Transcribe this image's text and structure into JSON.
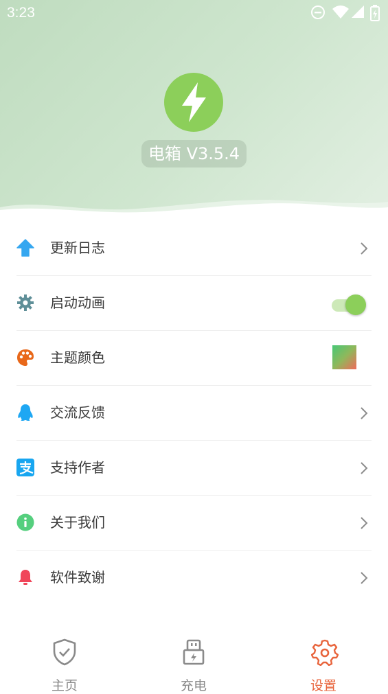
{
  "status_bar": {
    "time": "3:23",
    "icons": [
      "do-not-disturb-icon",
      "wifi-icon",
      "signal-icon",
      "battery-charging-icon"
    ]
  },
  "header": {
    "app_name": "电箱 V3.5.4",
    "logo_icon": "lightning-bolt-icon",
    "accent": "#8ccf5a"
  },
  "menu": {
    "items": [
      {
        "label": "更新日志",
        "icon": "arrow-up-icon",
        "icon_color": "#35a7f0",
        "trailing": "chevron"
      },
      {
        "label": "启动动画",
        "icon": "gear-icon",
        "icon_color": "#5f8f98",
        "trailing": "toggle",
        "toggle_on": true
      },
      {
        "label": "主题颜色",
        "icon": "palette-icon",
        "icon_color": "#e8681a",
        "trailing": "color-swatch"
      },
      {
        "label": "交流反馈",
        "icon": "qq-penguin-icon",
        "icon_color": "#1ea7f3",
        "trailing": "chevron"
      },
      {
        "label": "支持作者",
        "icon": "alipay-icon",
        "icon_color": "#18a6f0",
        "trailing": "chevron"
      },
      {
        "label": "关于我们",
        "icon": "info-icon",
        "icon_color": "#55cf7e",
        "trailing": "chevron"
      },
      {
        "label": "软件致谢",
        "icon": "bell-icon",
        "icon_color": "#f0465a",
        "trailing": "chevron"
      }
    ]
  },
  "bottom_nav": {
    "items": [
      {
        "label": "主页",
        "icon": "shield-check-icon",
        "active": false
      },
      {
        "label": "充电",
        "icon": "charger-plug-icon",
        "active": false
      },
      {
        "label": "设置",
        "icon": "settings-gear-icon",
        "active": true
      }
    ],
    "active_color": "#e8643c",
    "inactive_color": "#8a8a8a"
  }
}
